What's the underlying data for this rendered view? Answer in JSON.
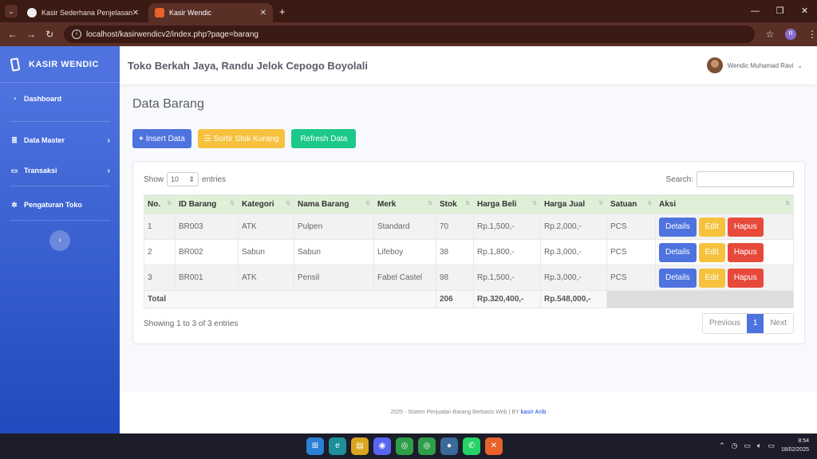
{
  "browser": {
    "tabs": [
      {
        "title": "Kasir Sederhana Penjelasan"
      },
      {
        "title": "Kasir Wendic"
      }
    ],
    "url": "localhost/kasirwendicv2/index.php?page=barang",
    "profile_initial": "R"
  },
  "sidebar": {
    "brand": "KASIR WENDIC",
    "items": [
      {
        "label": "Dashboard",
        "icon": "tachometer-icon"
      },
      {
        "label": "Data Master",
        "icon": "database-icon"
      },
      {
        "label": "Transaksi",
        "icon": "desktop-icon"
      },
      {
        "label": "Pengaturan Toko",
        "icon": "cogs-icon"
      }
    ]
  },
  "topbar": {
    "store": "Toko Berkah Jaya, Randu Jelok Cepogo Boyolali",
    "user": "Wendic Muhamad Ravi"
  },
  "page": {
    "title": "Data Barang",
    "buttons": {
      "insert": "Insert Data",
      "sortir": "Sortir Stok Kurang",
      "refresh": "Refresh Data"
    }
  },
  "table": {
    "show_label": "Show",
    "entries_value": "10",
    "entries_label": "entries",
    "search_label": "Search:",
    "headers": [
      "No.",
      "ID Barang",
      "Kategori",
      "Nama Barang",
      "Merk",
      "Stok",
      "Harga Beli",
      "Harga Jual",
      "Satuan",
      "Aksi"
    ],
    "rows": [
      [
        "1",
        "BR003",
        "ATK",
        "Pulpen",
        "Standard",
        "70",
        "Rp.1,500,-",
        "Rp.2,000,-",
        "PCS"
      ],
      [
        "2",
        "BR002",
        "Sabun",
        "Sabun",
        "Lifeboy",
        "38",
        "Rp.1,800,-",
        "Rp.3,000,-",
        "PCS"
      ],
      [
        "3",
        "BR001",
        "ATK",
        "Pensil",
        "Fabel Castel",
        "98",
        "Rp.1,500,-",
        "Rp.3,000,-",
        "PCS"
      ]
    ],
    "actions": {
      "details": "Details",
      "edit": "Edit",
      "hapus": "Hapus"
    },
    "total": {
      "label": "Total",
      "stok": "206",
      "beli": "Rp.320,400,-",
      "jual": "Rp.548,000,-"
    },
    "info": "Showing 1 to 3 of 3 entries",
    "pager": {
      "prev": "Previous",
      "current": "1",
      "next": "Next"
    }
  },
  "footer": {
    "text": "2025 - Sistem Penjualan Barang Berbasis Web | BY",
    "author": "kasir Arib"
  },
  "taskbar": {
    "time": "8:54",
    "date": "18/02/2025"
  }
}
